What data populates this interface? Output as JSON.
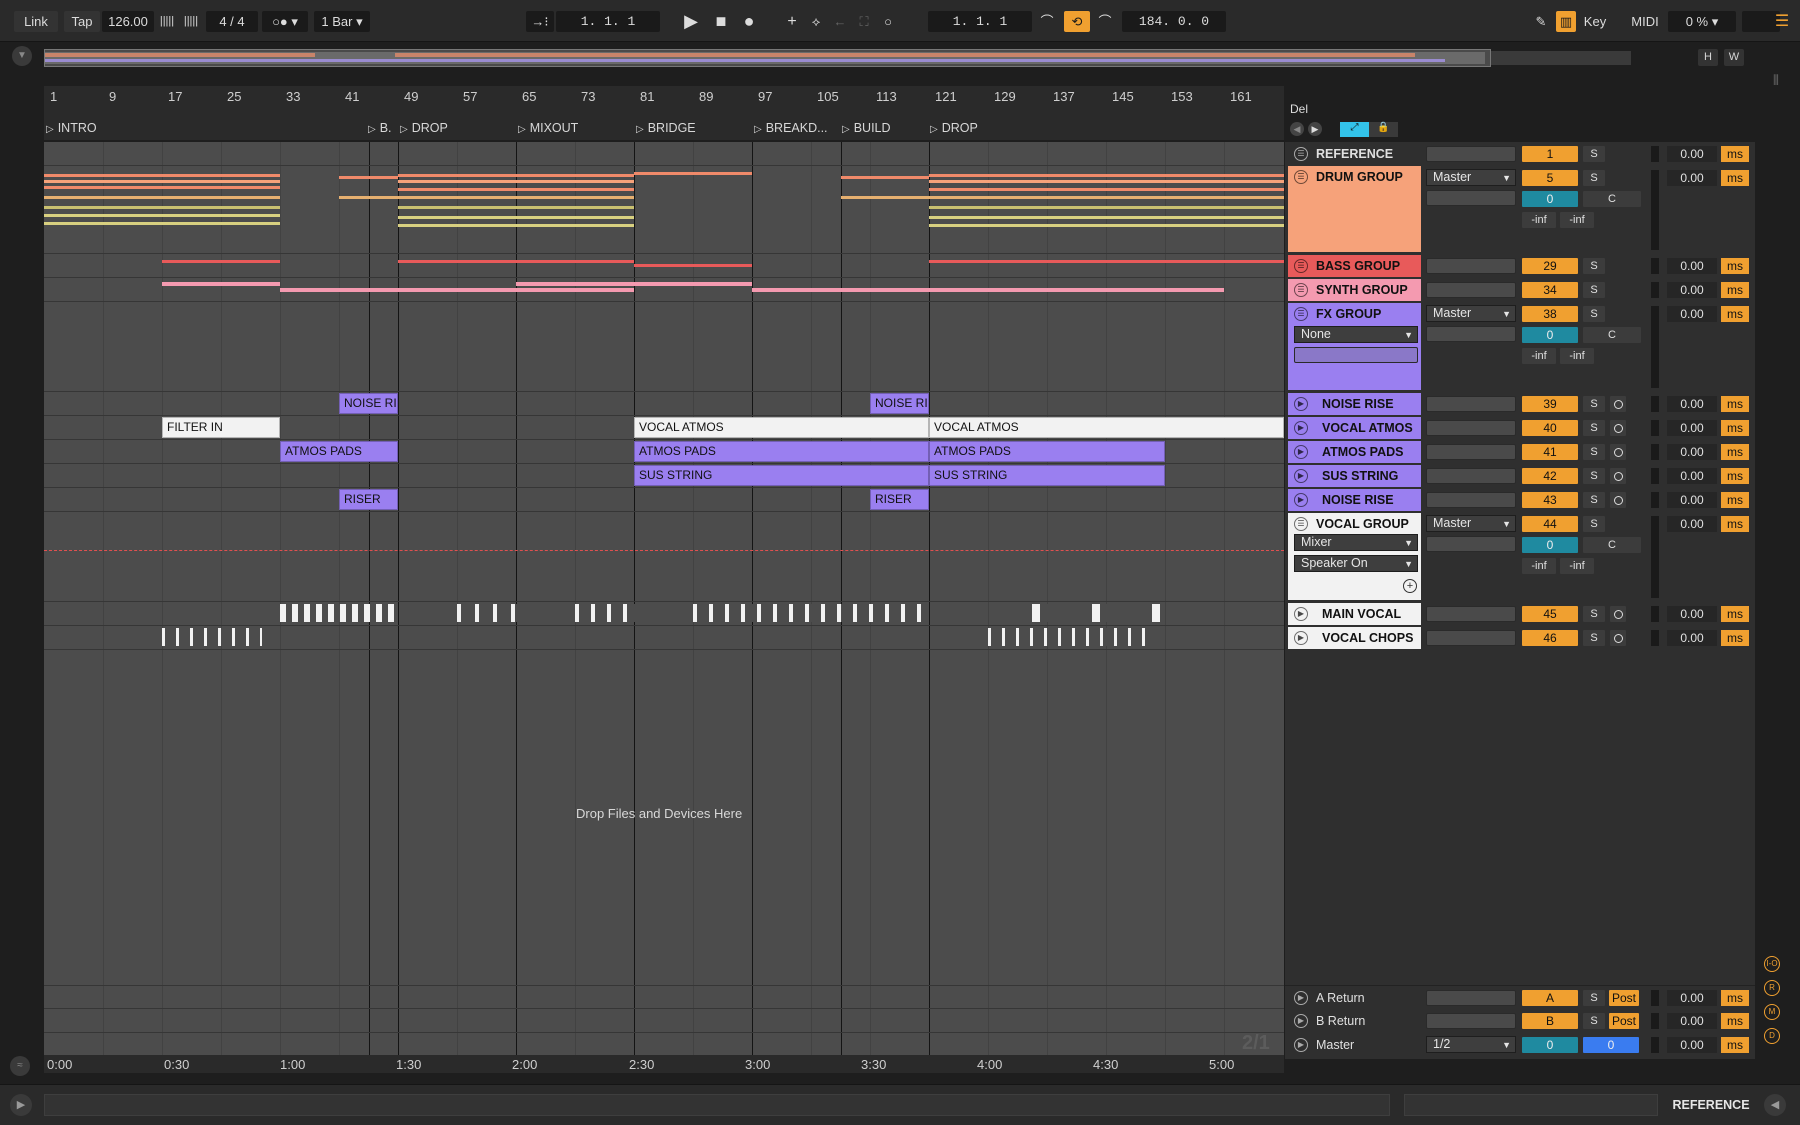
{
  "transport": {
    "link": "Link",
    "tap": "Tap",
    "tempo": "126.00",
    "signature": "4 / 4",
    "quantize": "1 Bar",
    "arrangement_position": "1.  1.  1",
    "loop_start": "1.  1.  1",
    "loop_length": "184.  0.  0",
    "key_label": "Key",
    "midi_label": "MIDI",
    "cpu": "0 %"
  },
  "overview": {
    "h": "H",
    "w": "W"
  },
  "ruler": {
    "bars": [
      "1",
      "9",
      "17",
      "25",
      "33",
      "41",
      "49",
      "57",
      "65",
      "73",
      "81",
      "89",
      "97",
      "105",
      "113",
      "121",
      "129",
      "137",
      "145",
      "153",
      "161"
    ]
  },
  "locators": {
    "del": "Del",
    "items": [
      {
        "label": "INTRO"
      },
      {
        "label": "B."
      },
      {
        "label": "DROP"
      },
      {
        "label": "MIXOUT"
      },
      {
        "label": "BRIDGE"
      },
      {
        "label": "BREAKD..."
      },
      {
        "label": "BUILD"
      },
      {
        "label": "DROP"
      }
    ]
  },
  "clips": {
    "noise_rise_1": "NOISE RI",
    "noise_rise_2": "NOISE RI",
    "filter_in": "FILTER IN",
    "vocal_atmos_1": "VOCAL ATMOS",
    "vocal_atmos_2": "VOCAL ATMOS",
    "atmos_pads_1": "ATMOS PADS",
    "atmos_pads_2": "ATMOS PADS",
    "atmos_pads_3": "ATMOS PADS",
    "sus_string_1": "SUS STRING",
    "sus_string_2": "SUS STRING",
    "riser_1": "RISER",
    "riser_2": "RISER"
  },
  "dropzone": "Drop Files and Devices Here",
  "page_indicator": "2/1",
  "time_ruler": [
    "0:00",
    "0:30",
    "1:00",
    "1:30",
    "2:00",
    "2:30",
    "3:00",
    "3:30",
    "4:00",
    "4:30",
    "5:00"
  ],
  "tracks": [
    {
      "name": "REFERENCE",
      "num": "1",
      "color": "#3a3a3a",
      "text": "#e0e0e0"
    },
    {
      "name": "DRUM GROUP",
      "num": "5",
      "color": "#f6a27a",
      "text": "#111",
      "routing": "Master",
      "pan": "0",
      "pan_c": "C",
      "inf_l": "-inf",
      "inf_r": "-inf"
    },
    {
      "name": "BASS GROUP",
      "num": "29",
      "color": "#e85a5a",
      "text": "#111"
    },
    {
      "name": "SYNTH GROUP",
      "num": "34",
      "color": "#f49ab0",
      "text": "#111"
    },
    {
      "name": "FX GROUP",
      "num": "38",
      "color": "#9a7ff0",
      "text": "#111",
      "routing": "Master",
      "input": "None",
      "pan": "0",
      "pan_c": "C",
      "inf_l": "-inf",
      "inf_r": "-inf"
    },
    {
      "name": "NOISE RISE",
      "num": "39",
      "color": "#9a7ff0",
      "text": "#111"
    },
    {
      "name": "VOCAL ATMOS",
      "num": "40",
      "color": "#9a7ff0",
      "text": "#111"
    },
    {
      "name": "ATMOS PADS",
      "num": "41",
      "color": "#9a7ff0",
      "text": "#111"
    },
    {
      "name": "SUS STRING",
      "num": "42",
      "color": "#9a7ff0",
      "text": "#111"
    },
    {
      "name": "NOISE RISE",
      "num": "43",
      "color": "#9a7ff0",
      "text": "#111"
    },
    {
      "name": "VOCAL GROUP",
      "num": "44",
      "color": "#f2f2f2",
      "text": "#111",
      "routing": "Master",
      "device": "Mixer",
      "speaker": "Speaker On",
      "pan": "0",
      "pan_c": "C",
      "inf_l": "-inf",
      "inf_r": "-inf"
    },
    {
      "name": "MAIN VOCAL",
      "num": "45",
      "color": "#f2f2f2",
      "text": "#111"
    },
    {
      "name": "VOCAL CHOPS",
      "num": "46",
      "color": "#f2f2f2",
      "text": "#111"
    }
  ],
  "solo_label": "S",
  "delay_value": "0.00",
  "delay_unit": "ms",
  "returns": [
    {
      "name": "A Return",
      "num": "A",
      "post": "Post"
    },
    {
      "name": "B Return",
      "num": "B",
      "post": "Post"
    },
    {
      "name": "Master",
      "num": "0",
      "num2": "0",
      "route": "1/2"
    }
  ],
  "side_buttons": [
    "I-O",
    "R",
    "M",
    "D"
  ],
  "bottom": {
    "selected_track": "REFERENCE"
  }
}
